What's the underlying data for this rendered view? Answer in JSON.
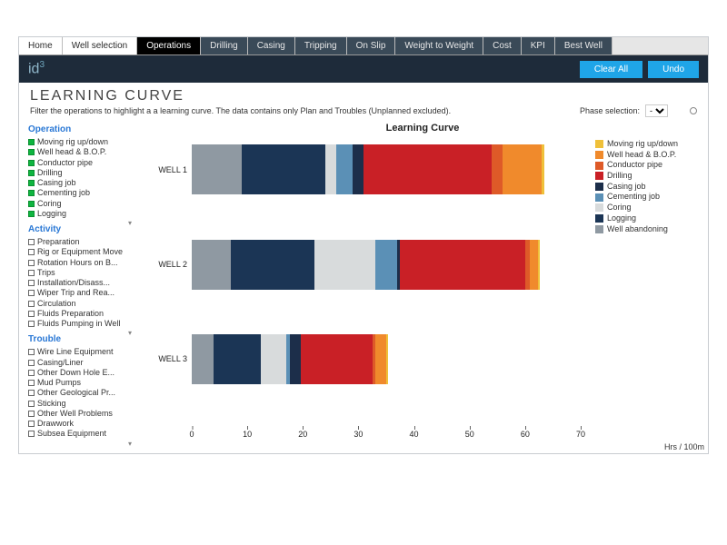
{
  "tabs": [
    "Home",
    "Well selection",
    "Operations",
    "Drilling",
    "Casing",
    "Tripping",
    "On Slip",
    "Weight to Weight",
    "Cost",
    "KPI",
    "Best Well"
  ],
  "active_tab_index": 2,
  "logo": {
    "text": "id",
    "sup": "3"
  },
  "buttons": {
    "clear": "Clear All",
    "undo": "Undo"
  },
  "header": {
    "title": "LEARNING CURVE",
    "subtitle": "Filter the operations to highlight a a learning curve. The data contains only Plan and Troubles (Unplanned excluded).",
    "phase_label": "Phase selection:",
    "phase_value": "-"
  },
  "filters": {
    "operation": {
      "title": "Operation",
      "items": [
        {
          "label": "Moving rig up/down",
          "on": true
        },
        {
          "label": "Well head & B.O.P.",
          "on": true
        },
        {
          "label": "Conductor pipe",
          "on": true
        },
        {
          "label": "Drilling",
          "on": true
        },
        {
          "label": "Casing job",
          "on": true
        },
        {
          "label": "Cementing job",
          "on": true
        },
        {
          "label": "Coring",
          "on": true
        },
        {
          "label": "Logging",
          "on": true
        }
      ]
    },
    "activity": {
      "title": "Activity",
      "items": [
        {
          "label": "Preparation",
          "on": false
        },
        {
          "label": "Rig or Equipment Move",
          "on": false
        },
        {
          "label": "Rotation Hours on B...",
          "on": false
        },
        {
          "label": "Trips",
          "on": false
        },
        {
          "label": "Installation/Disass...",
          "on": false
        },
        {
          "label": "Wiper Trip and Rea...",
          "on": false
        },
        {
          "label": "Circulation",
          "on": false
        },
        {
          "label": "Fluids Preparation",
          "on": false
        },
        {
          "label": "Fluids Pumping in Well",
          "on": false
        }
      ]
    },
    "trouble": {
      "title": "Trouble",
      "items": [
        {
          "label": "Wire Line Equipment",
          "on": false
        },
        {
          "label": "Casing/Liner",
          "on": false
        },
        {
          "label": "Other Down Hole E...",
          "on": false
        },
        {
          "label": "Mud Pumps",
          "on": false
        },
        {
          "label": "Other Geological Pr...",
          "on": false
        },
        {
          "label": "Sticking",
          "on": false
        },
        {
          "label": "Other Well Problems",
          "on": false
        },
        {
          "label": "Drawwork",
          "on": false
        },
        {
          "label": "Subsea Equipment",
          "on": false
        }
      ]
    }
  },
  "chart_data": {
    "type": "bar",
    "orientation": "horizontal",
    "stacked": true,
    "title": "Learning Curve",
    "xlabel": "Hrs / 100m",
    "xlim": [
      0,
      70
    ],
    "xticks": [
      0,
      10,
      20,
      30,
      40,
      50,
      60,
      70
    ],
    "categories": [
      "WELL 1",
      "WELL 2",
      "WELL 3"
    ],
    "series": [
      {
        "name": "Moving rig up/down",
        "color": "#efc03a",
        "values": [
          0.4,
          0.3,
          0.3
        ]
      },
      {
        "name": "Well head & B.O.P.",
        "color": "#f08a2c",
        "values": [
          7.0,
          1.5,
          2.0
        ]
      },
      {
        "name": "Conductor pipe",
        "color": "#de5a28",
        "values": [
          2.0,
          0.8,
          0.4
        ]
      },
      {
        "name": "Drilling",
        "color": "#c92026",
        "values": [
          23.0,
          22.5,
          13.0
        ]
      },
      {
        "name": "Casing job",
        "color": "#1c2e4a",
        "values": [
          2.0,
          0.5,
          2.0
        ]
      },
      {
        "name": "Cementing job",
        "color": "#5b90b6",
        "values": [
          3.0,
          4.0,
          0.6
        ]
      },
      {
        "name": "Coring",
        "color": "#d8dbdc",
        "values": [
          2.0,
          11.0,
          4.5
        ]
      },
      {
        "name": "Logging",
        "color": "#1b3555",
        "values": [
          15.0,
          15.0,
          8.5
        ]
      },
      {
        "name": "Well abandoning",
        "color": "#8f99a2",
        "values": [
          9.0,
          7.0,
          4.0
        ]
      }
    ],
    "legend_position": "right"
  }
}
